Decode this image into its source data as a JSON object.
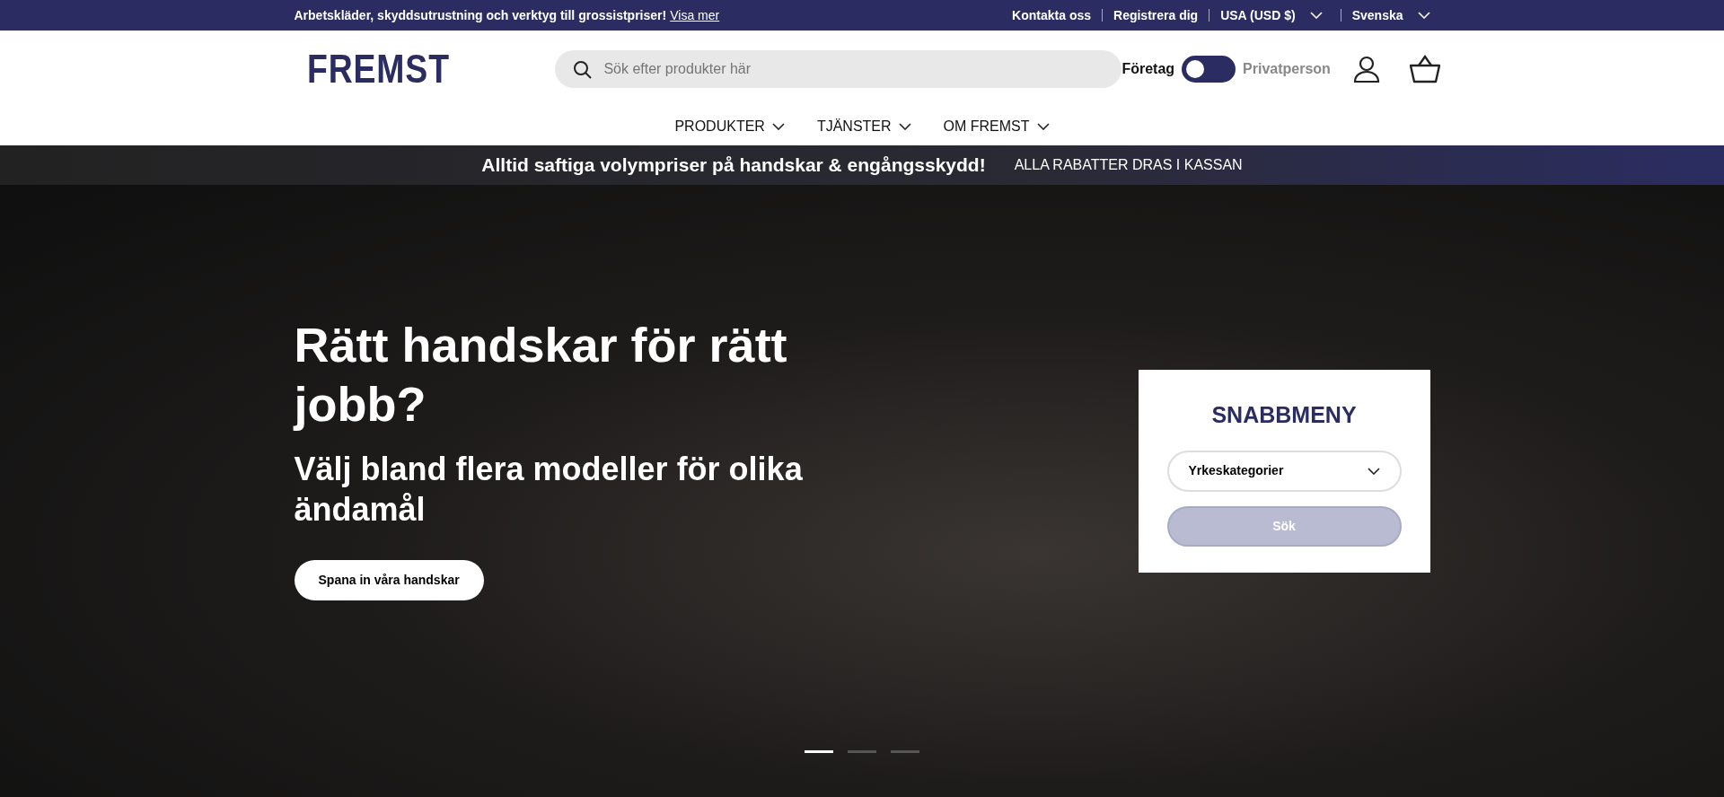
{
  "top_bar": {
    "promo": "Arbetskläder, skyddsutrustning och verktyg till grossistpriser!",
    "promo_link": "Visa mer",
    "links": [
      {
        "label": "Kontakta oss",
        "kind": "link"
      },
      {
        "label": "Registrera dig",
        "kind": "link"
      },
      {
        "label": "USA (USD $)",
        "kind": "dropdown"
      },
      {
        "label": "Svenska",
        "kind": "dropdown"
      }
    ]
  },
  "header": {
    "logo": "FREMST",
    "search": {
      "placeholder": "Sök efter produkter här"
    },
    "toggle": {
      "on": false
    },
    "customer_type": [
      {
        "label": "Företag",
        "selected": true
      },
      {
        "label": "Privatperson",
        "selected": false
      }
    ]
  },
  "nav": [
    {
      "label": "PRODUKTER"
    },
    {
      "label": "TJÄNSTER"
    },
    {
      "label": "OM FREMST"
    }
  ],
  "announcement": {
    "headline": "Alltid saftiga volympriser på handskar & engångsskydd!",
    "note": "ALLA RABATTER DRAS I KASSAN"
  },
  "hero": {
    "title": "Rätt handskar för rätt jobb?",
    "subtitle": "Välj bland flera modeller för olika ändamål",
    "button": "Spana in våra handskar",
    "slides": [
      {
        "selected": true
      },
      {
        "selected": false
      },
      {
        "selected": false
      }
    ]
  },
  "quick_menu": {
    "title": "SNABBMENY",
    "select": "Yrkeskategorier",
    "button": {
      "label": "Sök",
      "disabled": true
    }
  }
}
